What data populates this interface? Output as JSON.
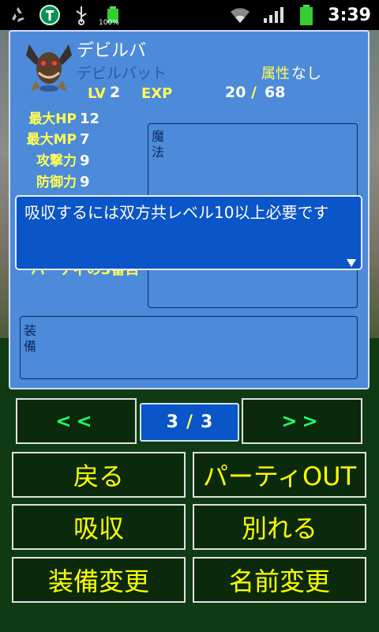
{
  "status_bar": {
    "battery_small_label": "100%",
    "time": "3:39"
  },
  "monster": {
    "name": "デビルバ",
    "species": "デビルバット",
    "attribute_label": "属性",
    "attribute_value": "なし",
    "lv_label": "LV",
    "lv_value": "2",
    "exp_label": "EXP",
    "exp_current": "20",
    "exp_separator": "/",
    "exp_max": "68"
  },
  "stats": [
    {
      "label": "最大HP",
      "value": "12"
    },
    {
      "label": "最大MP",
      "value": "7"
    },
    {
      "label": "攻撃力",
      "value": "9"
    },
    {
      "label": "防御力",
      "value": "9"
    }
  ],
  "magic_label": "魔法",
  "equipment_label": "装備",
  "party_note": "パーティの3番目",
  "dialog": {
    "message": "吸収するには双方共レベル10以上必要です"
  },
  "pager": {
    "prev_label": "<<",
    "next_label": ">>",
    "current": "3",
    "separator": "/",
    "total": "3"
  },
  "actions": {
    "back": "戻る",
    "party_out": "パーティOUT",
    "absorb": "吸収",
    "separate": "別れる",
    "change_equipment": "装備変更",
    "change_name": "名前変更"
  }
}
